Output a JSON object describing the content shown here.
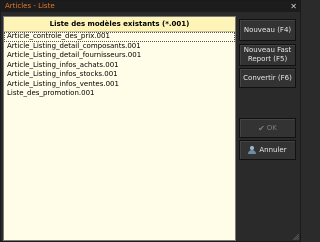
{
  "window": {
    "title": "Articles - Liste",
    "close_label": "✕"
  },
  "list": {
    "header": "Liste des modèles existants (*.001)",
    "items": [
      "Article_controle_des_prix.001",
      "Article_Listing_detail_composants.001",
      "Article_Listing_detail_fournisseurs.001",
      "Article_Listing_infos_achats.001",
      "Article_Listing_infos_stocks.001",
      "Article_Listing_infos_ventes.001",
      "Liste_des_promotion.001"
    ]
  },
  "buttons": {
    "nouveau": "Nouveau (F4)",
    "nouveau_fast_line1": "Nouveau Fast",
    "nouveau_fast_line2": "Report (F5)",
    "convertir": "Convertir (F6)",
    "ok": "OK",
    "annuler": "Annuler"
  },
  "colors": {
    "title": "#e37a2e",
    "list_background": "#fffde7",
    "header_background": "#fff4b8"
  }
}
